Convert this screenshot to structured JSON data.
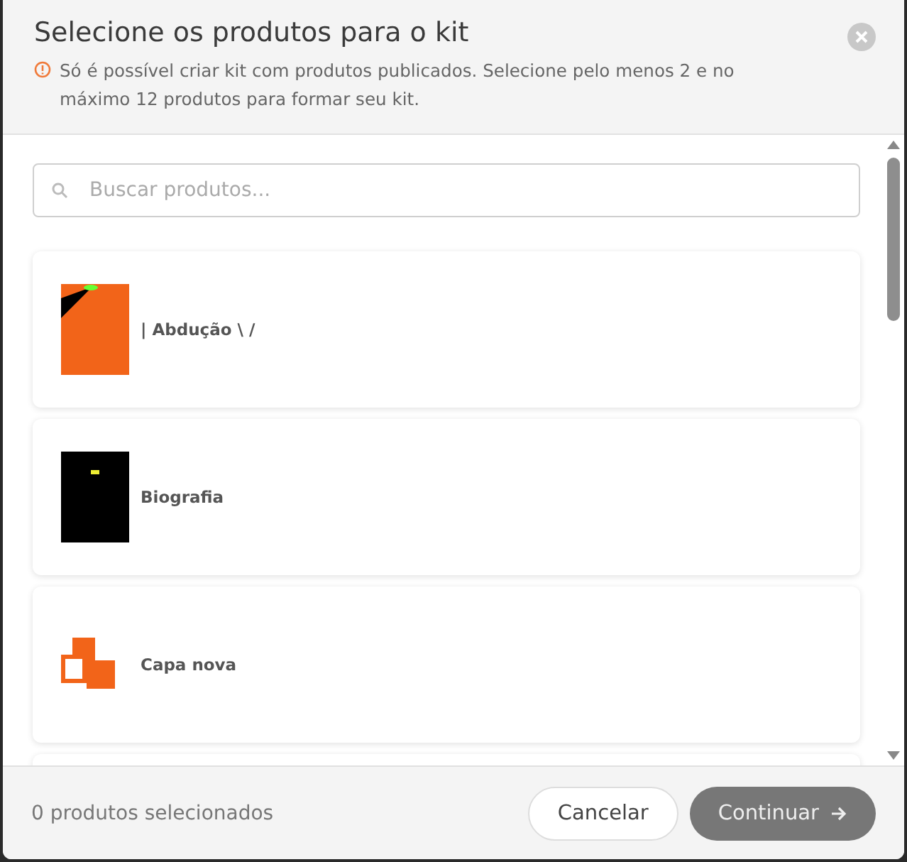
{
  "dialog": {
    "title": "Selecione os produtos para o kit",
    "notice": "Só é possível criar kit com produtos publicados. Selecione pelo menos 2 e no máximo 12 produtos para formar seu kit."
  },
  "search": {
    "placeholder": "Buscar produtos..."
  },
  "products": [
    {
      "name": "| Abdução \\ /",
      "kind": "picture"
    },
    {
      "name": "Biografia",
      "kind": "picture"
    },
    {
      "name": "Capa nova",
      "kind": "picture"
    }
  ],
  "footer": {
    "count": "0 produtos selecionados",
    "cancel": "Cancelar",
    "continue": {
      "label": "Continuar",
      "disabled": true
    }
  }
}
